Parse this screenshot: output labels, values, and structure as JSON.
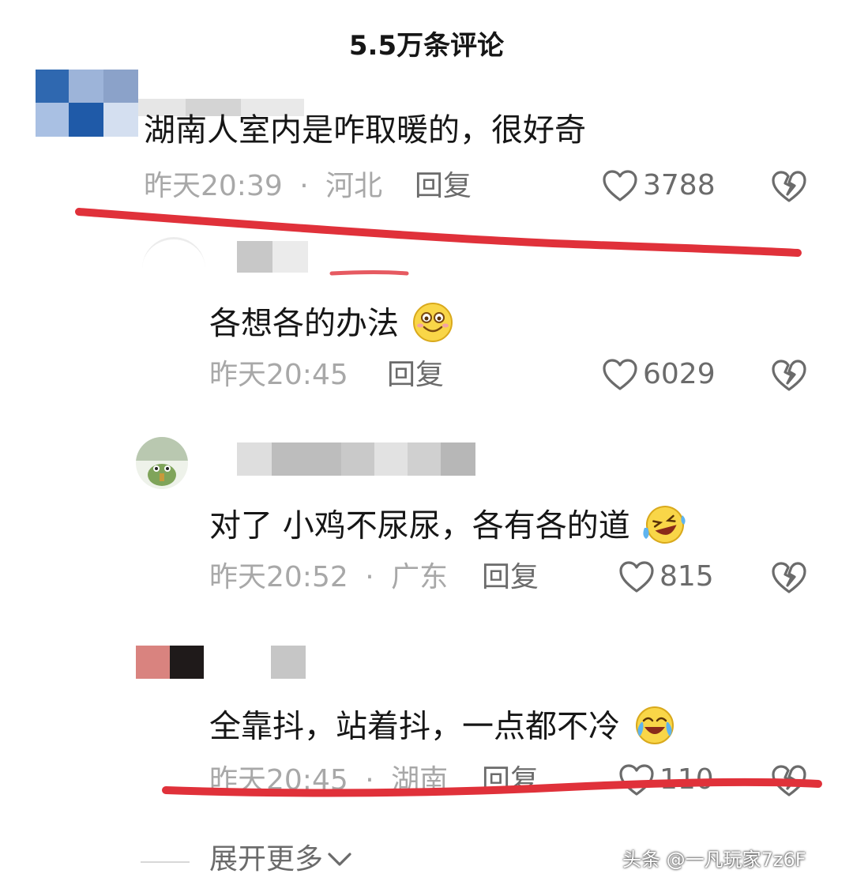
{
  "header": {
    "title": "5.5万条评论"
  },
  "comments": [
    {
      "text": "湖南人室内是咋取暖的，很好奇",
      "time": "昨天20:39",
      "location": "河北",
      "reply_label": "回复",
      "likes": "3788"
    },
    {
      "text": "各想各的办法",
      "emoji": "smile-emoji",
      "time": "昨天20:45",
      "location": "",
      "reply_label": "回复",
      "likes": "6029"
    },
    {
      "text": "对了 小鸡不尿尿，各有各的道",
      "emoji": "laughing-tears-emoji",
      "time": "昨天20:52",
      "location": "广东",
      "reply_label": "回复",
      "likes": "815"
    },
    {
      "text": "全靠抖，站着抖，一点都不冷",
      "emoji": "crying-laughing-emoji",
      "time": "昨天20:45",
      "location": "湖南",
      "reply_label": "回复",
      "likes": "110"
    }
  ],
  "meta_separator": "·",
  "expand": {
    "label": "展开更多"
  },
  "watermark": {
    "text": "头条 @一凡玩家7z6F"
  },
  "colors": {
    "text": "#161616",
    "meta": "#a8a8a8",
    "action": "#6b6b6b",
    "annotation_line": "#e0313a"
  },
  "icons": [
    "heart-outline-icon",
    "broken-heart-icon",
    "chevron-down-icon"
  ]
}
